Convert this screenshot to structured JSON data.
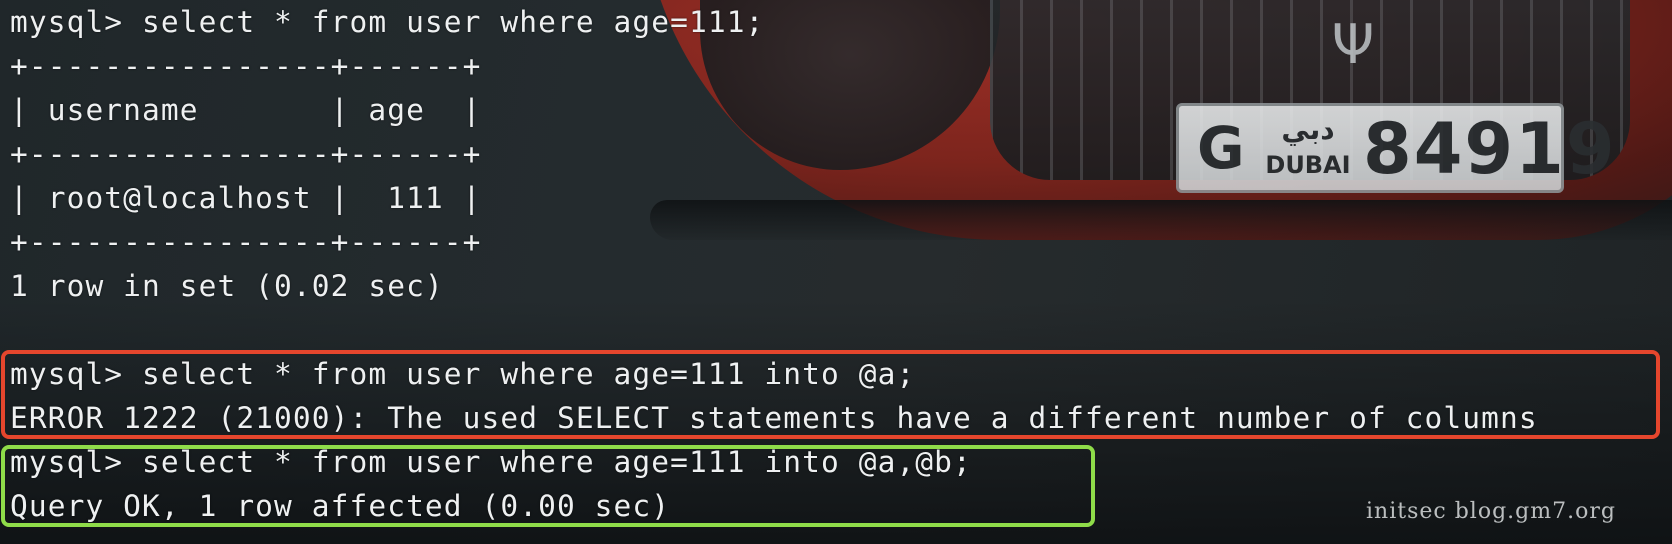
{
  "terminal": {
    "lines": [
      "mysql> select * from user where age=111;",
      "+----------------+------+",
      "| username       | age  |",
      "+----------------+------+",
      "| root@localhost |  111 |",
      "+----------------+------+",
      "1 row in set (0.02 sec)",
      "",
      "mysql> select * from user where age=111 into @a;",
      "ERROR 1222 (21000): The used SELECT statements have a different number of columns",
      "mysql> select * from user where age=111 into @a,@b;",
      "Query OK, 1 row affected (0.00 sec)"
    ]
  },
  "highlights": {
    "error_color": "#e5462d",
    "success_color": "#8fdc49"
  },
  "watermark": "initsec blog.gm7.org",
  "wallpaper": {
    "plate_letter": "G",
    "plate_arabic": "دبي",
    "plate_city": "DUBAI",
    "plate_number": "84919",
    "emblem_icon": "trident-icon"
  }
}
